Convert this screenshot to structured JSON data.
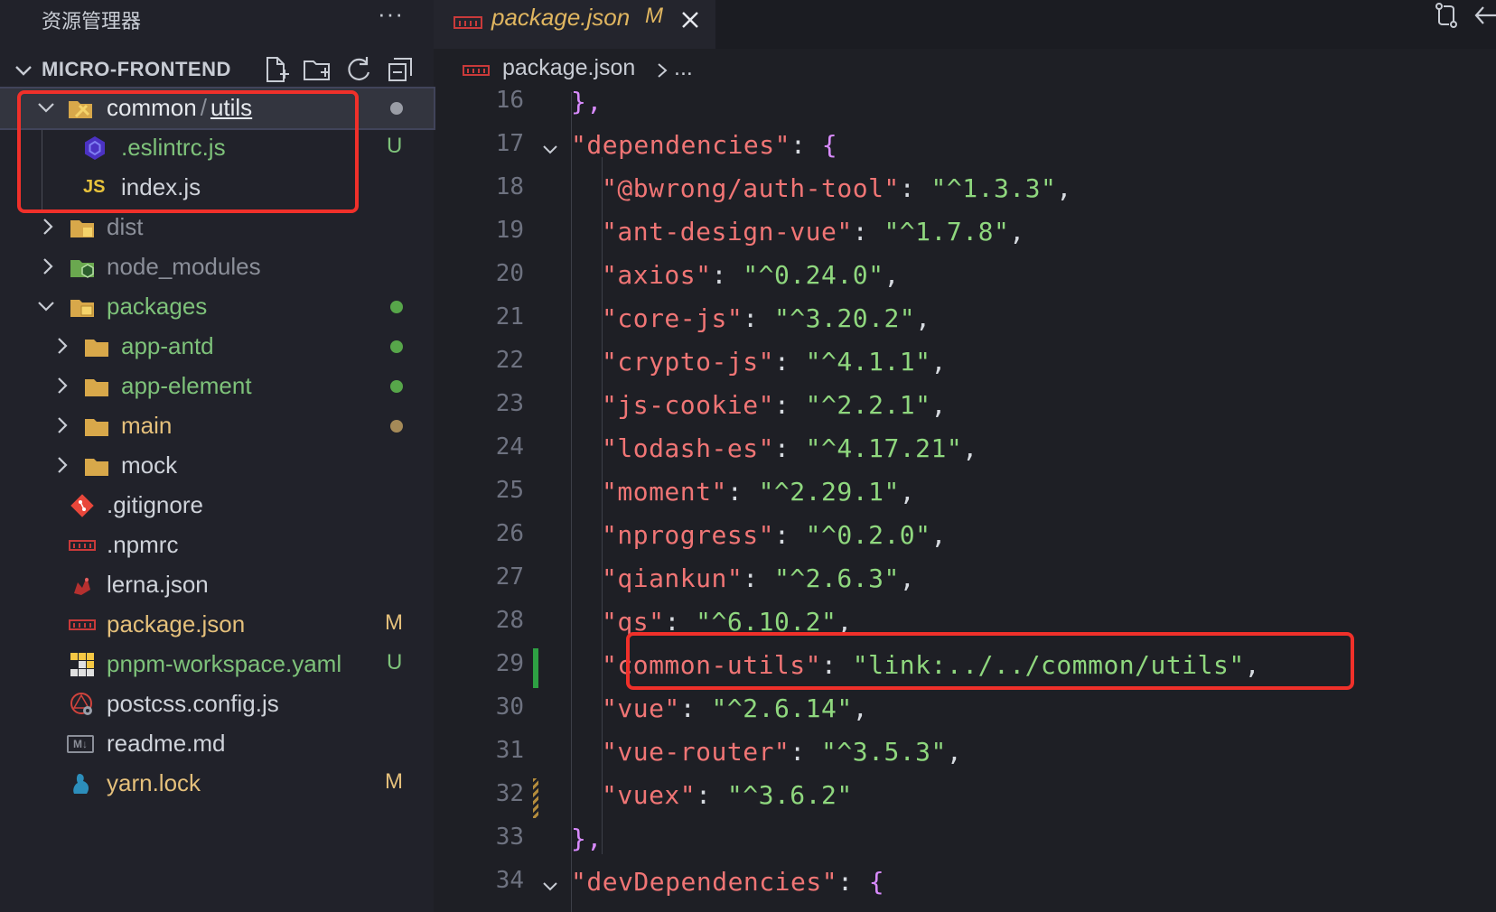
{
  "sidebar": {
    "title": "资源管理器",
    "more": "···",
    "section_title": "MICRO-FRONTEND",
    "actions": [
      "new-file-icon",
      "new-folder-icon",
      "refresh-icon",
      "collapse-all-icon"
    ],
    "items": [
      {
        "label_a": "common",
        "sep": "/",
        "label_b": "utils",
        "status": "dot",
        "color": "#cfd3da"
      },
      {
        "label": ".eslintrc.js",
        "status": "U",
        "color": "#7ec27a"
      },
      {
        "label": "index.js",
        "status": "",
        "color": "#cfd3da"
      },
      {
        "label": "dist",
        "status": "",
        "color": "#8b8f99"
      },
      {
        "label": "node_modules",
        "status": "",
        "color": "#8b8f99"
      },
      {
        "label": "packages",
        "status": "dot",
        "color": "#7ec27a"
      },
      {
        "label": "app-antd",
        "status": "dot",
        "color": "#7ec27a"
      },
      {
        "label": "app-element",
        "status": "dot",
        "color": "#7ec27a"
      },
      {
        "label": "main",
        "status": "dot",
        "color": "#e5c07b"
      },
      {
        "label": "mock",
        "status": "",
        "color": "#cfd3da"
      },
      {
        "label": ".gitignore",
        "status": "",
        "color": "#cfd3da"
      },
      {
        "label": ".npmrc",
        "status": "",
        "color": "#cfd3da"
      },
      {
        "label": "lerna.json",
        "status": "",
        "color": "#cfd3da"
      },
      {
        "label": "package.json",
        "status": "M",
        "color": "#e5c07b"
      },
      {
        "label": "pnpm-workspace.yaml",
        "status": "U",
        "color": "#7ec27a"
      },
      {
        "label": "postcss.config.js",
        "status": "",
        "color": "#cfd3da"
      },
      {
        "label": "readme.md",
        "status": "",
        "color": "#cfd3da"
      },
      {
        "label": "yarn.lock",
        "status": "M",
        "color": "#e5c07b"
      }
    ]
  },
  "icons": {
    "js_text": "JS",
    "markdown_text": "M↓"
  },
  "editor": {
    "tab": {
      "label": "package.json",
      "badge": "M"
    },
    "breadcrumb": {
      "file": "package.json",
      "more": "..."
    },
    "lines": [
      {
        "n": "16",
        "text": "},"
      },
      {
        "n": "17",
        "key": "\"dependencies\"",
        "open": "{"
      },
      {
        "n": "18",
        "key": "\"@bwrong/auth-tool\"",
        "val": "\"^1.3.3\""
      },
      {
        "n": "19",
        "key": "\"ant-design-vue\"",
        "val": "\"^1.7.8\""
      },
      {
        "n": "20",
        "key": "\"axios\"",
        "val": "\"^0.24.0\""
      },
      {
        "n": "21",
        "key": "\"core-js\"",
        "val": "\"^3.20.2\""
      },
      {
        "n": "22",
        "key": "\"crypto-js\"",
        "val": "\"^4.1.1\""
      },
      {
        "n": "23",
        "key": "\"js-cookie\"",
        "val": "\"^2.2.1\""
      },
      {
        "n": "24",
        "key": "\"lodash-es\"",
        "val": "\"^4.17.21\""
      },
      {
        "n": "25",
        "key": "\"moment\"",
        "val": "\"^2.29.1\""
      },
      {
        "n": "26",
        "key": "\"nprogress\"",
        "val": "\"^0.2.0\""
      },
      {
        "n": "27",
        "key": "\"qiankun\"",
        "val": "\"^2.6.3\""
      },
      {
        "n": "28",
        "key": "\"qs\"",
        "val": "\"^6.10.2\""
      },
      {
        "n": "29",
        "key": "\"common-utils\"",
        "val": "\"link:../../common/utils\""
      },
      {
        "n": "30",
        "key": "\"vue\"",
        "val": "\"^2.6.14\""
      },
      {
        "n": "31",
        "key": "\"vue-router\"",
        "val": "\"^3.5.3\""
      },
      {
        "n": "32",
        "key": "\"vuex\"",
        "val": "\"^3.6.2\"",
        "last": true
      },
      {
        "n": "33",
        "text": "},"
      },
      {
        "n": "34",
        "key": "\"devDependencies\"",
        "open": "{"
      }
    ]
  },
  "colors": {
    "highlight_box": "#f0302a",
    "git_added": "#7ec27a",
    "git_modified": "#e5c07b",
    "json_key": "#f07575",
    "json_string": "#8fd77e"
  }
}
